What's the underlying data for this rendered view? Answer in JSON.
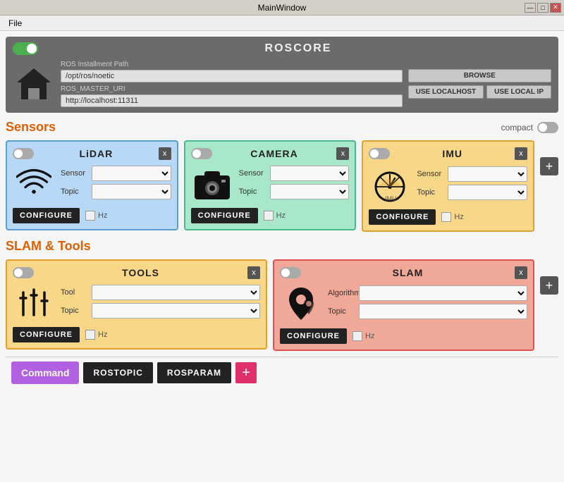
{
  "titlebar": {
    "title": "MainWindow",
    "minimize": "—",
    "maximize": "□",
    "close": "✕"
  },
  "menubar": {
    "file_label": "File"
  },
  "roscore": {
    "title": "ROSCORE",
    "ros_path_label": "ROS Installment Path",
    "ros_path_value": "/opt/ros/noetic",
    "ros_uri_label": "ROS_MASTER_URI",
    "ros_uri_value": "http://localhost:11311",
    "browse_btn": "BROWSE",
    "localhost_btn": "USE LOCALHOST",
    "local_ip_btn": "USE LOCAL IP"
  },
  "sensors_section": {
    "title": "Sensors",
    "compact_label": "compact",
    "add_btn": "+"
  },
  "sensors": [
    {
      "id": "lidar",
      "title": "LiDAR",
      "sensor_label": "Sensor",
      "topic_label": "Topic",
      "configure_btn": "CONFIGURE",
      "hz_label": "Hz",
      "toggle_on": false
    },
    {
      "id": "camera",
      "title": "CAMERA",
      "sensor_label": "Sensor",
      "topic_label": "Topic",
      "configure_btn": "CONFIGURE",
      "hz_label": "Hz",
      "toggle_on": false
    },
    {
      "id": "imu",
      "title": "IMU",
      "sensor_label": "Sensor",
      "topic_label": "Topic",
      "configure_btn": "CONFIGURE",
      "hz_label": "Hz",
      "toggle_on": false
    }
  ],
  "slam_section": {
    "title": "SLAM & Tools",
    "add_btn": "+"
  },
  "slam_tools": [
    {
      "id": "tools",
      "title": "TOOLS",
      "field1_label": "Tool",
      "field2_label": "Topic",
      "configure_btn": "CONFIGURE",
      "hz_label": "Hz",
      "toggle_on": false
    },
    {
      "id": "slam",
      "title": "SLAM",
      "field1_label": "Algorithm",
      "field2_label": "Topic",
      "configure_btn": "CONFIGURE",
      "hz_label": "Hz",
      "toggle_on": false
    }
  ],
  "command_bar": {
    "label": "Command",
    "btn1": "ROSTOPIC",
    "btn2": "ROSPARAM",
    "add_btn": "+"
  }
}
